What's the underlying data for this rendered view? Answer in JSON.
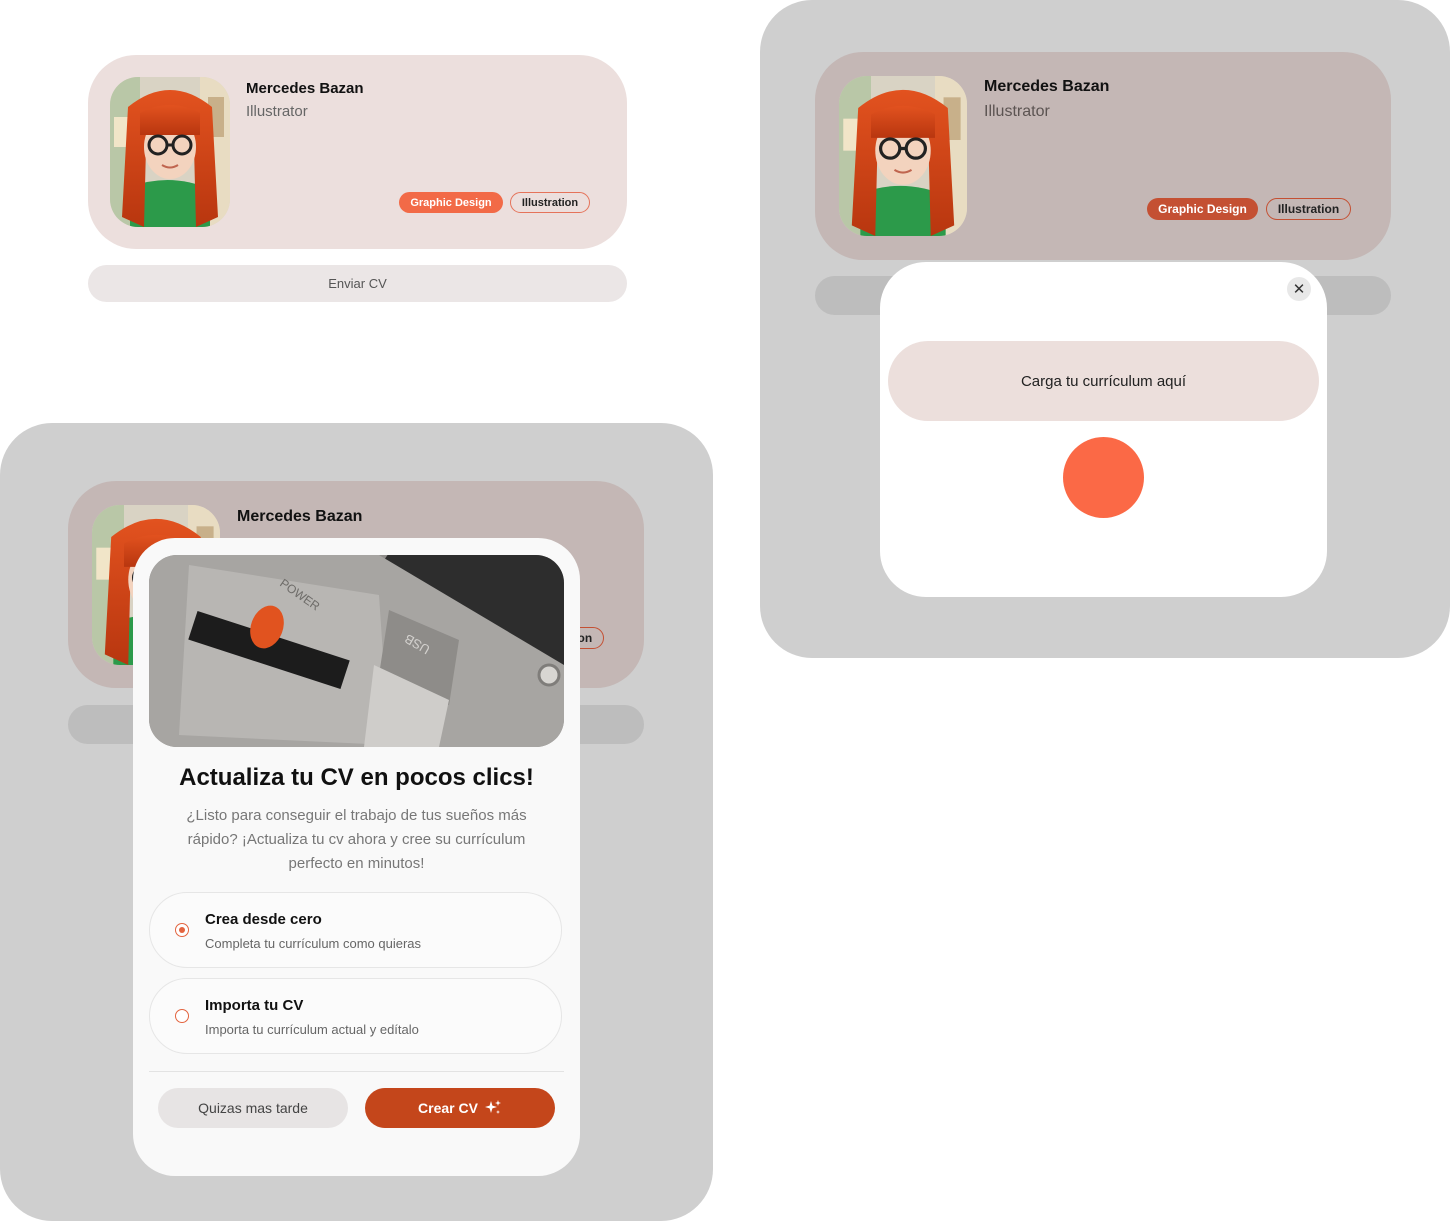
{
  "profile": {
    "name": "Mercedes Bazan",
    "role": "Illustrator",
    "tags": [
      "Graphic Design",
      "Illustration"
    ],
    "send_cv_label": "Enviar CV"
  },
  "upload_modal": {
    "close_glyph": "✕",
    "upload_label": "Carga tu currículum aquí"
  },
  "cv_modal": {
    "title": "Actualiza tu CV en pocos clics!",
    "description": "¿Listo para conseguir el trabajo de tus sueños más rápido? ¡Actualiza tu cv ahora y cree su currículum perfecto en minutos!",
    "options": [
      {
        "title": "Crea desde cero",
        "subtitle": "Completa tu currículum como quieras",
        "selected": true
      },
      {
        "title": "Importa tu CV",
        "subtitle": "Importa tu currículum actual y edítalo",
        "selected": false
      }
    ],
    "later_label": "Quizas mas tarde",
    "create_label": "Crear CV",
    "create_icon": "sparkle-icon"
  },
  "colors": {
    "accent": "#f26a47",
    "accent_dark": "#c4461b",
    "card_bg": "#ecdfdd",
    "overlay_panel": "#cfcfcf"
  }
}
